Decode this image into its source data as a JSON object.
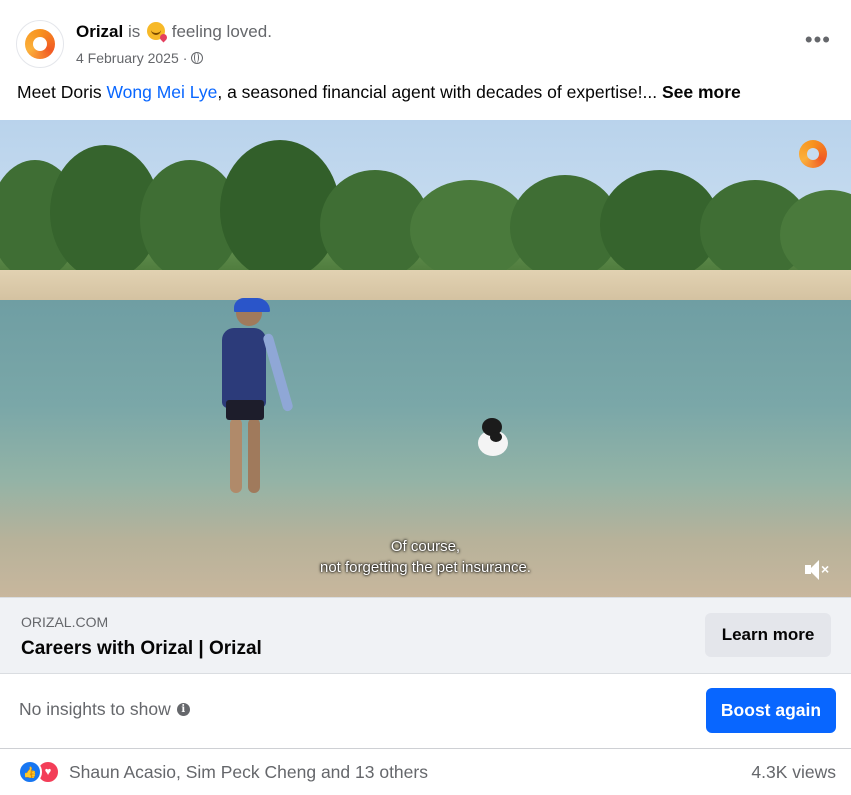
{
  "post": {
    "page_name": "Orizal",
    "activity_prefix": "is",
    "activity": "feeling loved.",
    "activity_emoji": "loved-emoji",
    "date": "4 February 2025",
    "audience_separator": "·",
    "audience_icon": "globe-icon",
    "more_options": "•••",
    "text_before": "Meet Doris ",
    "mention": "Wong Mei Lye",
    "text_after": ", a seasoned financial agent with decades of expertise!...",
    "see_more": "See more"
  },
  "video": {
    "caption_line1": "Of course,",
    "caption_line2": "not forgetting the pet insurance.",
    "muted": true,
    "watermark": "orizal-logo"
  },
  "link_preview": {
    "domain": "ORIZAL.COM",
    "title": "Careers with Orizal | Orizal",
    "cta": "Learn more"
  },
  "insights": {
    "text": "No insights to show",
    "info_icon": "i",
    "boost_label": "Boost again"
  },
  "footer": {
    "reaction_like": "👍",
    "reaction_love": "♥",
    "reactors": "Shaun Acasio, Sim Peck Cheng and 13 others",
    "views": "4.3K views"
  },
  "colors": {
    "link_blue": "#0866ff",
    "boost_blue": "#0866ff",
    "brand_orange": "#f7931e",
    "like_blue": "#1877f2",
    "love_red": "#f33e58"
  }
}
